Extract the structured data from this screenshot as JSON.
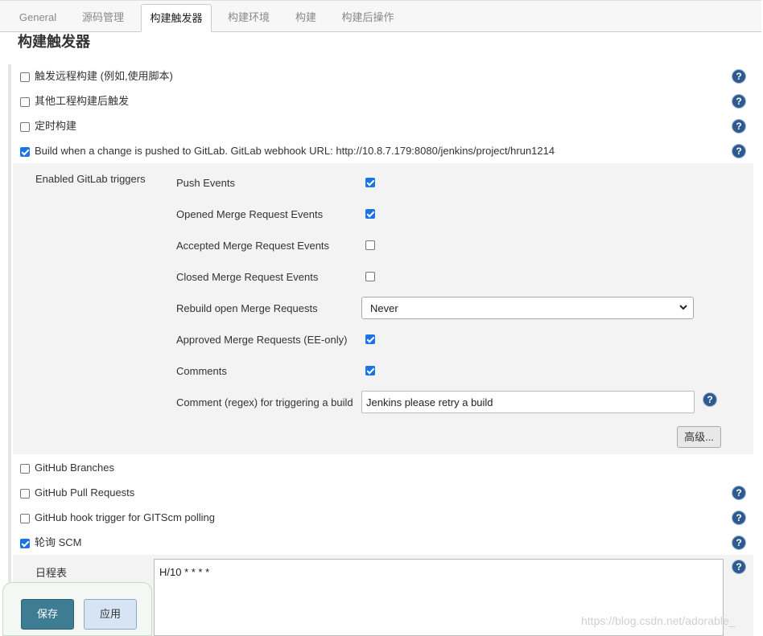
{
  "tabs": [
    "General",
    "源码管理",
    "构建触发器",
    "构建环境",
    "构建",
    "构建后操作"
  ],
  "section_title": "构建触发器",
  "triggers": {
    "remote": "触发远程构建 (例如,使用脚本)",
    "after_other": "其他工程构建后触发",
    "periodic": "定时构建",
    "gitlab": "Build when a change is pushed to GitLab. GitLab webhook URL: http://10.8.7.179:8080/jenkins/project/hrun1214",
    "github_branches": "GitHub Branches",
    "github_pr": "GitHub Pull Requests",
    "github_hook": "GitHub hook trigger for GITScm polling",
    "poll_scm": "轮询 SCM"
  },
  "gitlab": {
    "enabled_label": "Enabled GitLab triggers",
    "push": "Push Events",
    "opened_mr": "Opened Merge Request Events",
    "accepted_mr": "Accepted Merge Request Events",
    "closed_mr": "Closed Merge Request Events",
    "rebuild_label": "Rebuild open Merge Requests",
    "rebuild_value": "Never",
    "approved_mr": "Approved Merge Requests (EE-only)",
    "comments": "Comments",
    "comment_regex_label": "Comment (regex) for triggering a build",
    "comment_regex_value": "Jenkins please retry a build",
    "advanced": "高级..."
  },
  "schedule": {
    "label": "日程表",
    "value": "H/10 * * * *"
  },
  "buttons": {
    "save": "保存",
    "apply": "应用"
  },
  "watermark": "https://blog.csdn.net/adorable_",
  "colors": {
    "checkbox_checked": "#1a73e8",
    "help_icon": "#2f5a8f",
    "save_button": "#3d7c93",
    "apply_button": "#d6e4f3"
  }
}
